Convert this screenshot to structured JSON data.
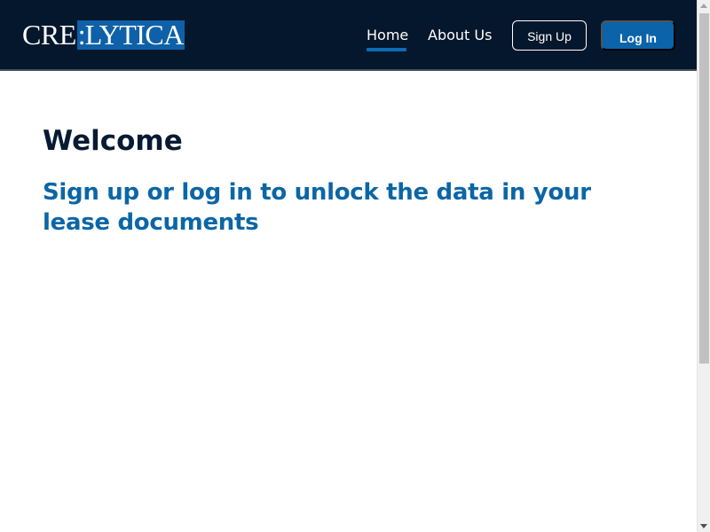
{
  "header": {
    "logo": {
      "left_text": "CRE",
      "separator": ":",
      "right_text": "LYTICA",
      "brand_color": "#0e61a8"
    },
    "nav": {
      "home": "Home",
      "about": "About Us"
    },
    "active_nav": "Home",
    "signup_label": "Sign Up",
    "login_label": "Log In",
    "background_color": "#04172c",
    "accent_color": "#0b63a9"
  },
  "main": {
    "title": "Welcome",
    "subtitle": "Sign up or log in to unlock the data in your lease documents",
    "title_color": "#061a33",
    "subtitle_color": "#0b66a6"
  }
}
